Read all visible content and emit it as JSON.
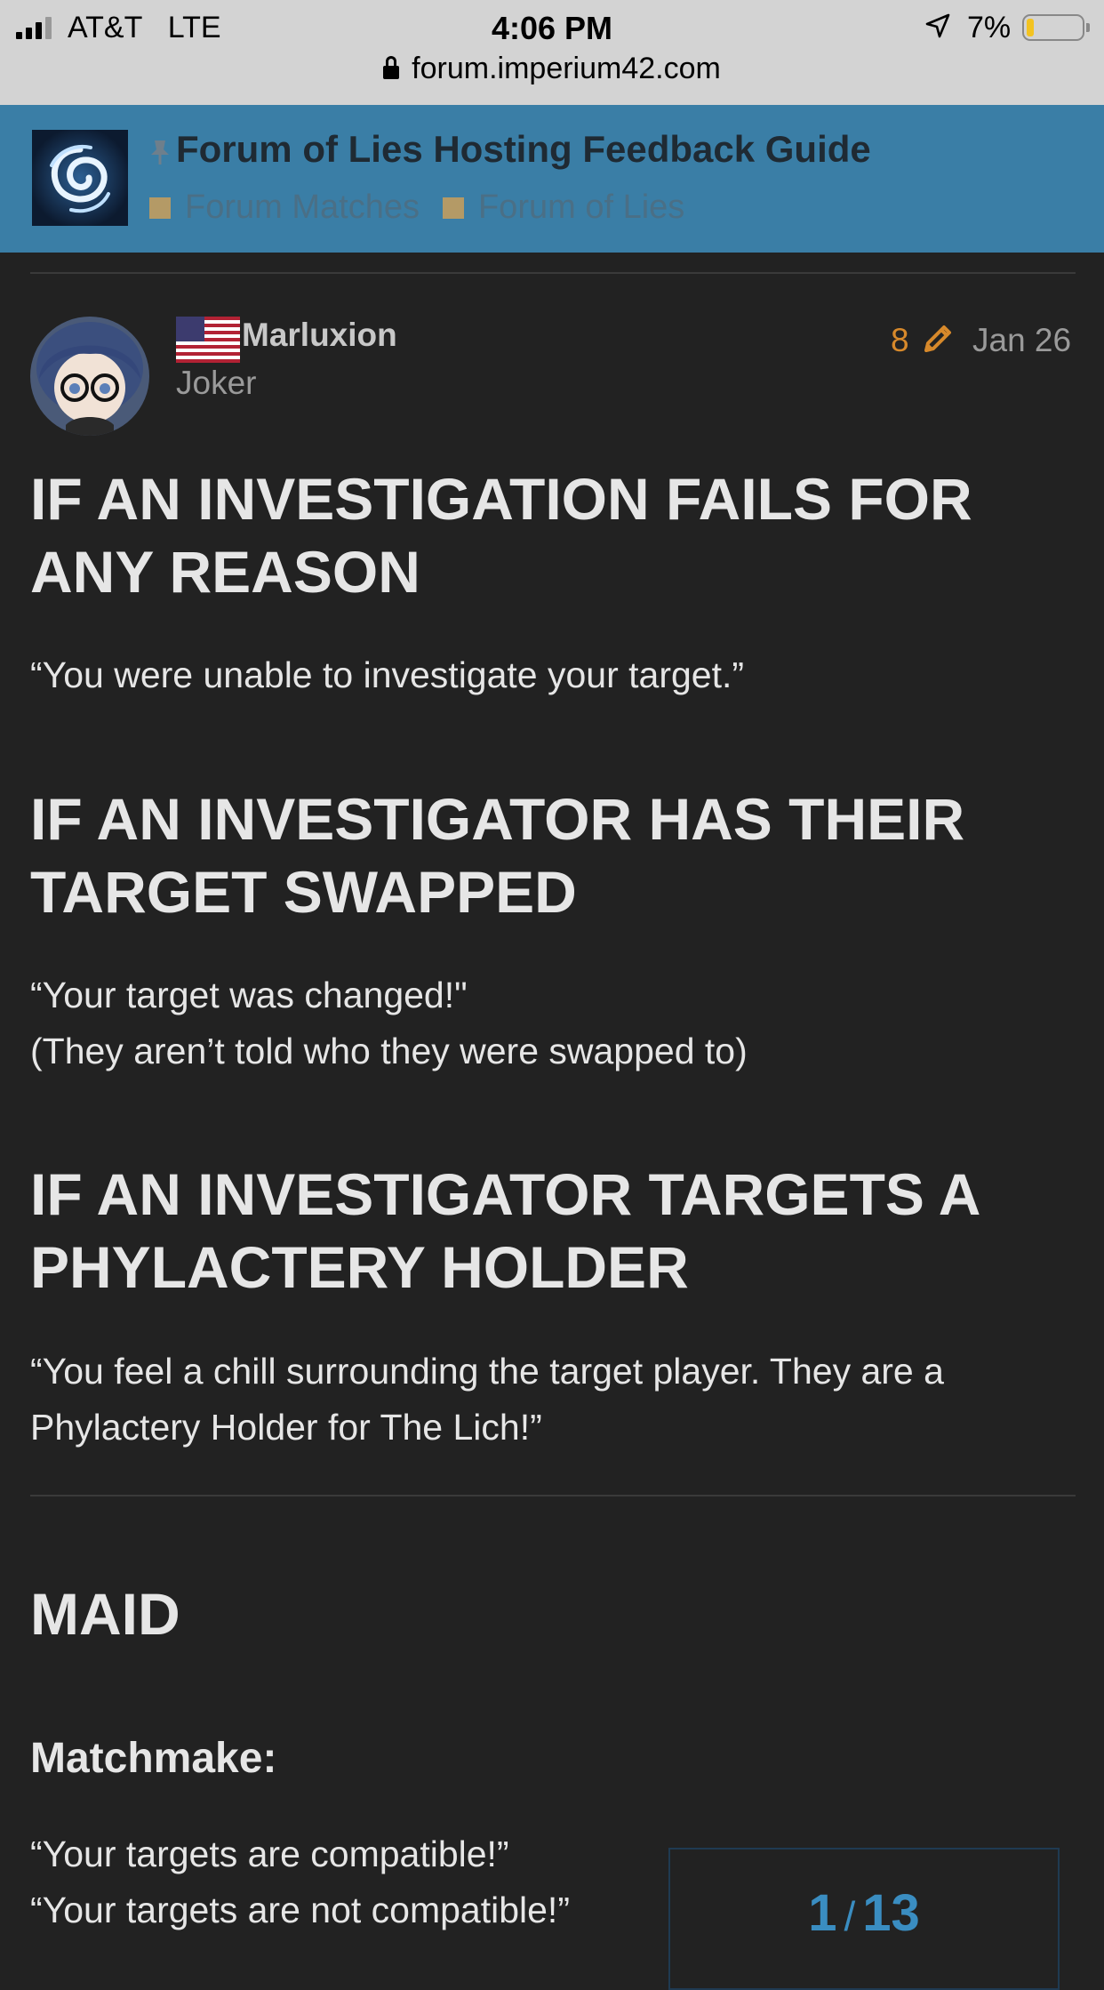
{
  "status_bar": {
    "carrier": "AT&T",
    "network": "LTE",
    "time": "4:06 PM",
    "battery": "7%",
    "url": "forum.imperium42.com"
  },
  "header": {
    "title": "Forum of Lies Hosting Feedback Guide",
    "categories": [
      "Forum Matches",
      "Forum of Lies"
    ]
  },
  "post": {
    "username": "Marluxion",
    "user_title": "Joker",
    "edit_count": "8",
    "date": "Jan 26",
    "sections": [
      {
        "heading_lines": [
          "IF AN INVESTIGATION FAILS FOR",
          "ANY REASON"
        ],
        "body_lines": [
          "“You were unable to investigate your target.”"
        ]
      },
      {
        "heading_lines": [
          "IF AN INVESTIGATOR HAS THEIR",
          "TARGET SWAPPED"
        ],
        "body_lines": [
          "“Your target was changed!\"",
          "(They aren’t told who they were swapped to)"
        ]
      },
      {
        "heading_lines": [
          "IF AN INVESTIGATOR TARGETS A",
          "PHYLACTERY HOLDER"
        ],
        "body_lines": [
          "“You feel a chill surrounding the target player. They are a",
          "Phylactery Holder for The Lich!”"
        ]
      }
    ],
    "role_heading": "MAID",
    "subheading": "Matchmake:",
    "matchmake_lines": [
      "“Your targets are compatible!”",
      "“Your targets are not compatible!”"
    ]
  },
  "progress": {
    "current": "1",
    "total": "13"
  },
  "colors": {
    "background": "#222222",
    "header": "#3a7ea6",
    "accent_orange": "#d7892b",
    "progress_blue": "#3a8dc1"
  }
}
